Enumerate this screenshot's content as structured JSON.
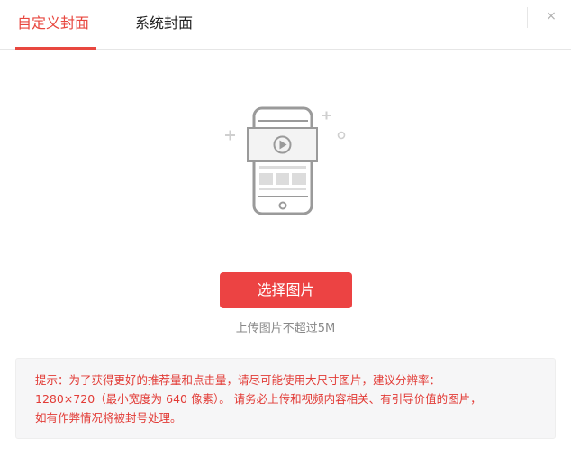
{
  "tabs": [
    {
      "label": "自定义封面",
      "active": true
    },
    {
      "label": "系统封面",
      "active": false
    }
  ],
  "close_label": "×",
  "upload_button_label": "选择图片",
  "size_hint": "上传图片不超过5M",
  "notice": {
    "line1": "提示：为了获得更好的推荐量和点击量，请尽可能使用大尺寸图片，建议分辨率：",
    "line2": "1280×720（最小宽度为 640 像素）。 请务必上传和视频内容相关、有引导价值的图片，",
    "line3": "如有作弊情况将被封号处理。"
  },
  "colors": {
    "accent": "#e8473f",
    "button": "#ec4343",
    "notice_text": "#e23b36",
    "notice_bg": "#f6f6f7"
  },
  "icons": [
    "phone-video-illustration",
    "close-icon",
    "play-icon"
  ]
}
